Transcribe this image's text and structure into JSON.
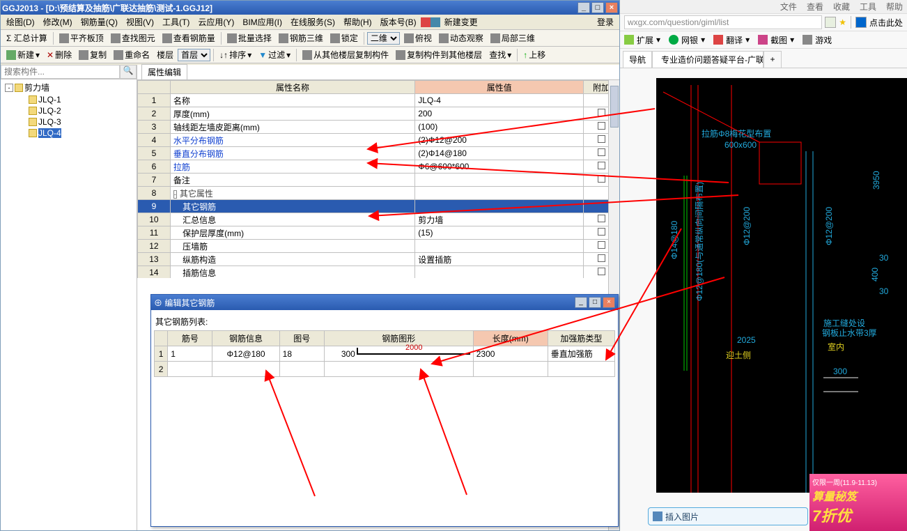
{
  "window": {
    "title": "GGJ2013 - [D:\\预结算及抽筋\\广联达抽筋\\测试-1.GGJ12]"
  },
  "menu": {
    "items": [
      "绘图(D)",
      "修改(M)",
      "钢筋量(Q)",
      "视图(V)",
      "工具(T)",
      "云应用(Y)",
      "BIM应用(I)",
      "在线服务(S)",
      "帮助(H)",
      "版本号(B)"
    ],
    "extra": "新建变更",
    "login": "登录"
  },
  "toolbar1": {
    "items": [
      "Σ 汇总计算",
      "平齐板顶",
      "查找图元",
      "查看钢筋量",
      "批量选择",
      "钢筋三维",
      "锁定",
      "二维",
      "俯视",
      "动态观察",
      "局部三维"
    ]
  },
  "toolbar2": {
    "new": "新建",
    "del": "删除",
    "copy": "复制",
    "rename": "重命名",
    "floor_lbl": "楼层",
    "floor_val": "首层",
    "sort": "排序",
    "filter": "过滤",
    "copy_from": "从其他楼层复制构件",
    "copy_to": "复制构件到其他楼层",
    "find": "查找",
    "up": "上移"
  },
  "search": {
    "placeholder": "搜索构件..."
  },
  "tree": {
    "root": "剪力墙",
    "items": [
      "JLQ-1",
      "JLQ-2",
      "JLQ-3",
      "JLQ-4"
    ],
    "selected_index": 3
  },
  "prop_tab": {
    "label": "属性编辑"
  },
  "prop_headers": {
    "name": "属性名称",
    "value": "属性值",
    "extra": "附加"
  },
  "prop_rows": [
    {
      "n": "名称",
      "v": "JLQ-4",
      "link": false,
      "ck": false
    },
    {
      "n": "厚度(mm)",
      "v": "200",
      "link": false,
      "ck": true
    },
    {
      "n": "轴线距左墙皮距离(mm)",
      "v": "(100)",
      "link": false,
      "ck": true
    },
    {
      "n": "水平分布钢筋",
      "v": "(2)Φ12@200",
      "link": true,
      "ck": true
    },
    {
      "n": "垂直分布钢筋",
      "v": "(2)Φ14@180",
      "link": true,
      "ck": true
    },
    {
      "n": "拉筋",
      "v": "Φ6@600*600",
      "link": true,
      "ck": true
    },
    {
      "n": "备注",
      "v": "",
      "link": false,
      "ck": true
    },
    {
      "n": "其它属性",
      "v": "",
      "link": false,
      "ck": false,
      "grp": true
    },
    {
      "n": "其它钢筋",
      "v": "",
      "link": false,
      "ck": false,
      "sel": true,
      "indent": true
    },
    {
      "n": "汇总信息",
      "v": "剪力墙",
      "link": false,
      "ck": true,
      "indent": true
    },
    {
      "n": "保护层厚度(mm)",
      "v": "(15)",
      "link": false,
      "ck": true,
      "indent": true
    },
    {
      "n": "压墙筋",
      "v": "",
      "link": false,
      "ck": true,
      "indent": true
    },
    {
      "n": "纵筋构造",
      "v": "设置插筋",
      "link": false,
      "ck": true,
      "indent": true
    },
    {
      "n": "插筋信息",
      "v": "",
      "link": false,
      "ck": true,
      "indent": true
    }
  ],
  "dialog": {
    "title": "编辑其它钢筋",
    "subtitle": "其它钢筋列表:",
    "headers": [
      "筋号",
      "钢筋信息",
      "图号",
      "钢筋图形",
      "长度(mm)",
      "加强筋类型"
    ],
    "rows": [
      {
        "rn": "1",
        "no": "1",
        "info": "Φ12@180",
        "fig": "18",
        "shape_left": "300",
        "shape_top": "2000",
        "len": "2300",
        "type": "垂直加强筋"
      }
    ]
  },
  "browser": {
    "top_menu": [
      "文件",
      "查看",
      "收藏",
      "工具",
      "帮助"
    ],
    "addr": "wxgx.com/question/giml/list",
    "click_hint": "点击此处",
    "toolbar": {
      "ext": "扩展",
      "bank": "网银",
      "trans": "翻译",
      "shot": "截图",
      "game": "游戏"
    },
    "tabs": {
      "t1": "导航",
      "t2": "专业造价问题答疑平台-广联达"
    },
    "insert_img": "插入图片"
  },
  "cad_labels": {
    "l1": "拉筋Φ8梅花型布置",
    "l2": "600x600",
    "l3": "Φ14@180",
    "l4": "Φ12@200",
    "l5": "Φ12@200",
    "l6": "Φ12@180(与通常纵向间隔布置)",
    "l7": "2025",
    "l8": "迎土侧",
    "l9": "室内",
    "l10": "施工缝处设",
    "l11": "钢板止水带3厚",
    "l12": "300",
    "d1": "3950",
    "d2": "30",
    "d3": "400",
    "d4": "30"
  },
  "promo": {
    "p1": "仅限一周(11.9-11.13)",
    "p2": "算量秘笈",
    "p3": "7折优"
  }
}
